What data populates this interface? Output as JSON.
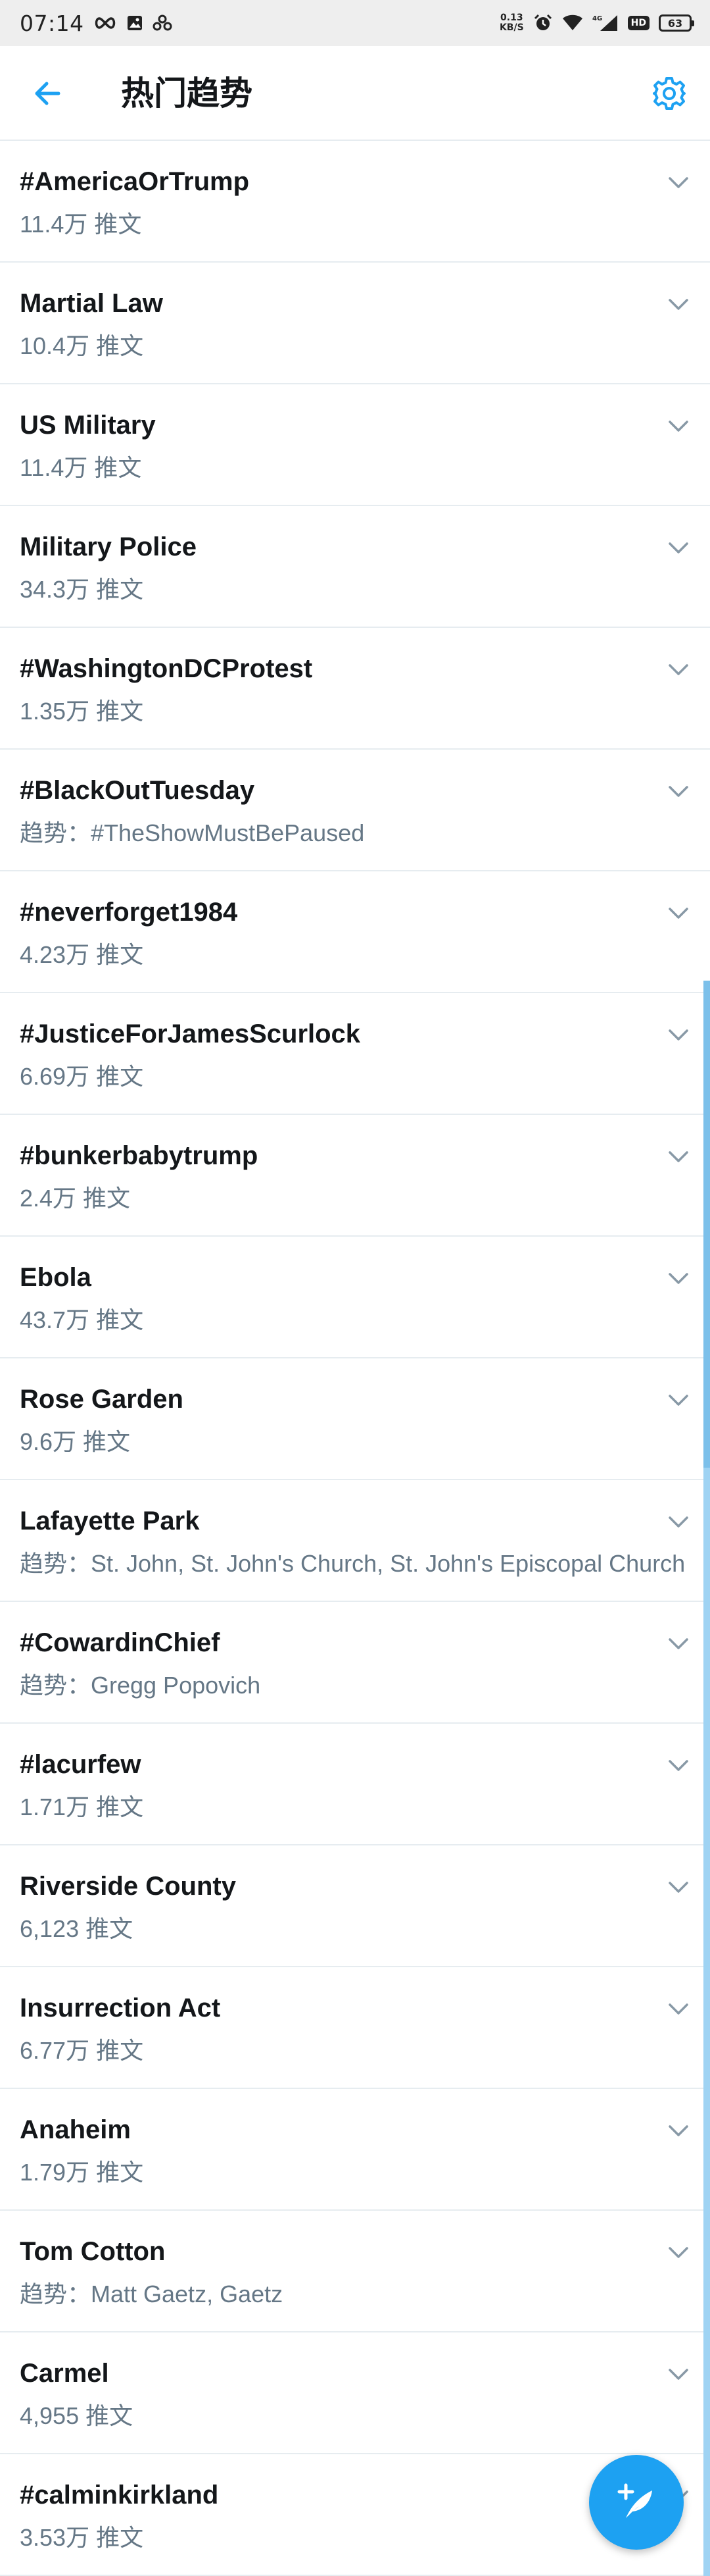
{
  "status_bar": {
    "time": "07:14",
    "net_speed_value": "0.13",
    "net_speed_unit": "KB/S",
    "hd_label": "HD",
    "battery": "63"
  },
  "header": {
    "title": "热门趋势"
  },
  "trends": [
    {
      "name": "#AmericaOrTrump",
      "meta": "11.4万 推文"
    },
    {
      "name": "Martial Law",
      "meta": "10.4万 推文"
    },
    {
      "name": "US Military",
      "meta": "11.4万 推文"
    },
    {
      "name": "Military Police",
      "meta": "34.3万 推文"
    },
    {
      "name": "#WashingtonDCProtest",
      "meta": "1.35万 推文"
    },
    {
      "name": "#BlackOutTuesday",
      "meta": "趋势：#TheShowMustBePaused"
    },
    {
      "name": "#neverforget1984",
      "meta": "4.23万 推文"
    },
    {
      "name": "#JusticeForJamesScurlock",
      "meta": "6.69万 推文"
    },
    {
      "name": "#bunkerbabytrump",
      "meta": "2.4万 推文"
    },
    {
      "name": "Ebola",
      "meta": "43.7万 推文"
    },
    {
      "name": "Rose Garden",
      "meta": "9.6万 推文"
    },
    {
      "name": "Lafayette Park",
      "meta": "趋势：St. John, St. John's Church, St. John's Episcopal Church"
    },
    {
      "name": "#CowardinChief",
      "meta": "趋势：Gregg Popovich"
    },
    {
      "name": "#lacurfew",
      "meta": "1.71万 推文"
    },
    {
      "name": "Riverside County",
      "meta": "6,123 推文"
    },
    {
      "name": "Insurrection Act",
      "meta": "6.77万 推文"
    },
    {
      "name": "Anaheim",
      "meta": "1.79万 推文"
    },
    {
      "name": "Tom Cotton",
      "meta": "趋势：Matt Gaetz, Gaetz"
    },
    {
      "name": "Carmel",
      "meta": "4,955 推文"
    },
    {
      "name": "#calminkirkland",
      "meta": "3.53万 推文"
    }
  ],
  "colors": {
    "accent": "#1da1f2",
    "secondary_text": "#657786",
    "divider": "#e6ecf0"
  },
  "icons": {
    "back": "arrow-left-icon",
    "settings": "gear-icon",
    "expand": "chevron-down-icon",
    "compose": "compose-tweet-icon"
  }
}
